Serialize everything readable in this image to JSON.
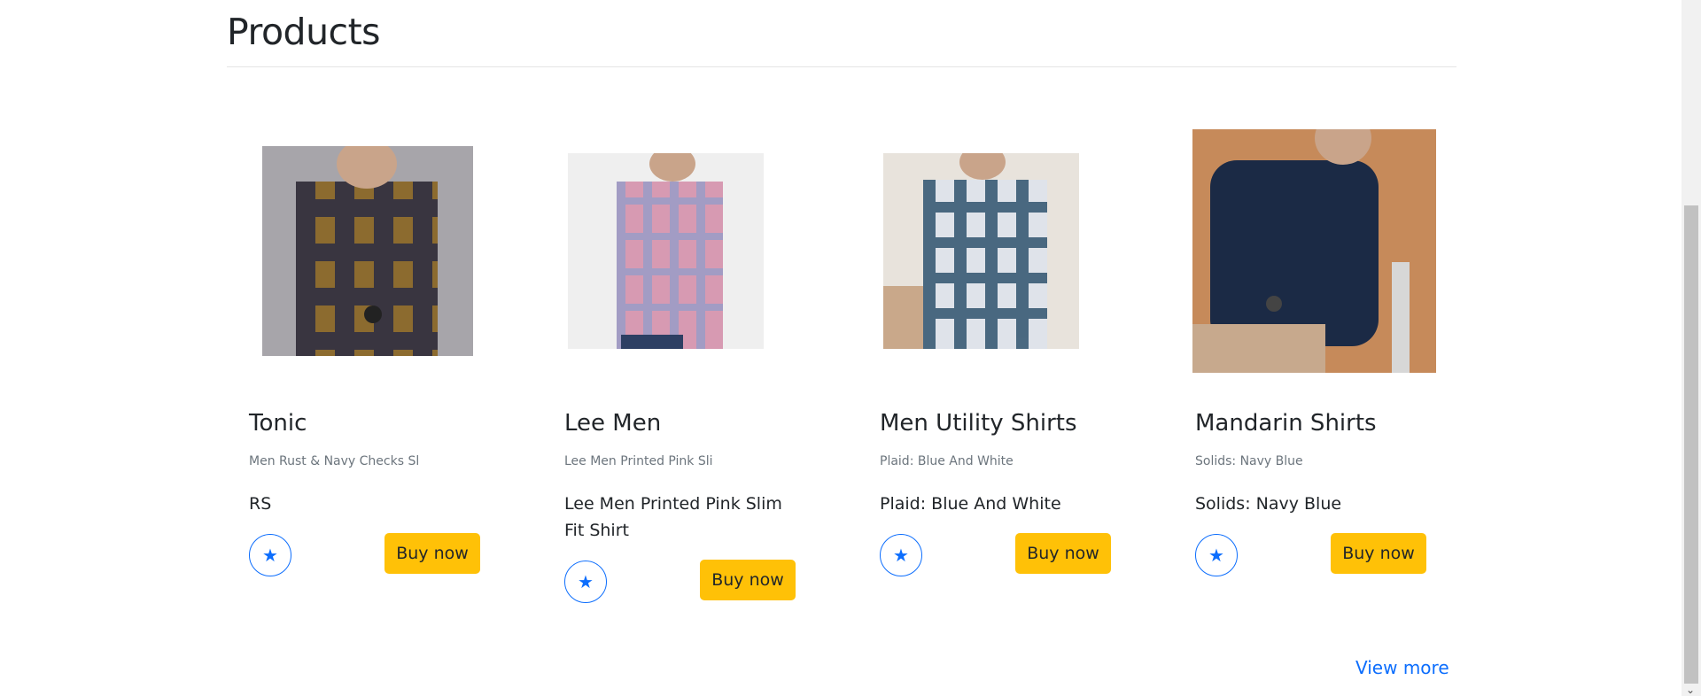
{
  "page": {
    "title": "Products"
  },
  "products": [
    {
      "title": "Tonic",
      "subtitle": "Men Rust & Navy Checks Sl",
      "description": "RS",
      "buy_label": "Buy now",
      "fav_icon": "star-icon",
      "image_colors": {
        "bg": "#a7a5aa",
        "shirt": "#8c6b2f",
        "check": "#1e2446"
      }
    },
    {
      "title": "Lee Men",
      "subtitle": "Lee Men Printed Pink Sli",
      "description": "Lee Men Printed Pink Slim Fit Shirt",
      "buy_label": "Buy now",
      "fav_icon": "star-icon",
      "image_colors": {
        "bg": "#efefef",
        "shirt": "#d79ab2",
        "check": "#7f9ed0"
      }
    },
    {
      "title": "Men Utility Shirts",
      "subtitle": "Plaid: Blue And White",
      "description": "Plaid: Blue And White",
      "buy_label": "Buy now",
      "fav_icon": "star-icon",
      "image_colors": {
        "bg": "#e8e3dc",
        "shirt": "#dfe3ea",
        "check": "#244a66"
      }
    },
    {
      "title": "Mandarin Shirts",
      "subtitle": "Solids: Navy Blue",
      "description": "Solids: Navy Blue",
      "buy_label": "Buy now",
      "fav_icon": "star-icon",
      "image_colors": {
        "bg": "#c68a5a",
        "shirt": "#1b2a45",
        "check": "#1b2a45"
      }
    }
  ],
  "footer": {
    "view_more": "View more"
  },
  "colors": {
    "accent": "#0d6efd",
    "buy": "#ffc107",
    "muted": "#6c757d"
  }
}
